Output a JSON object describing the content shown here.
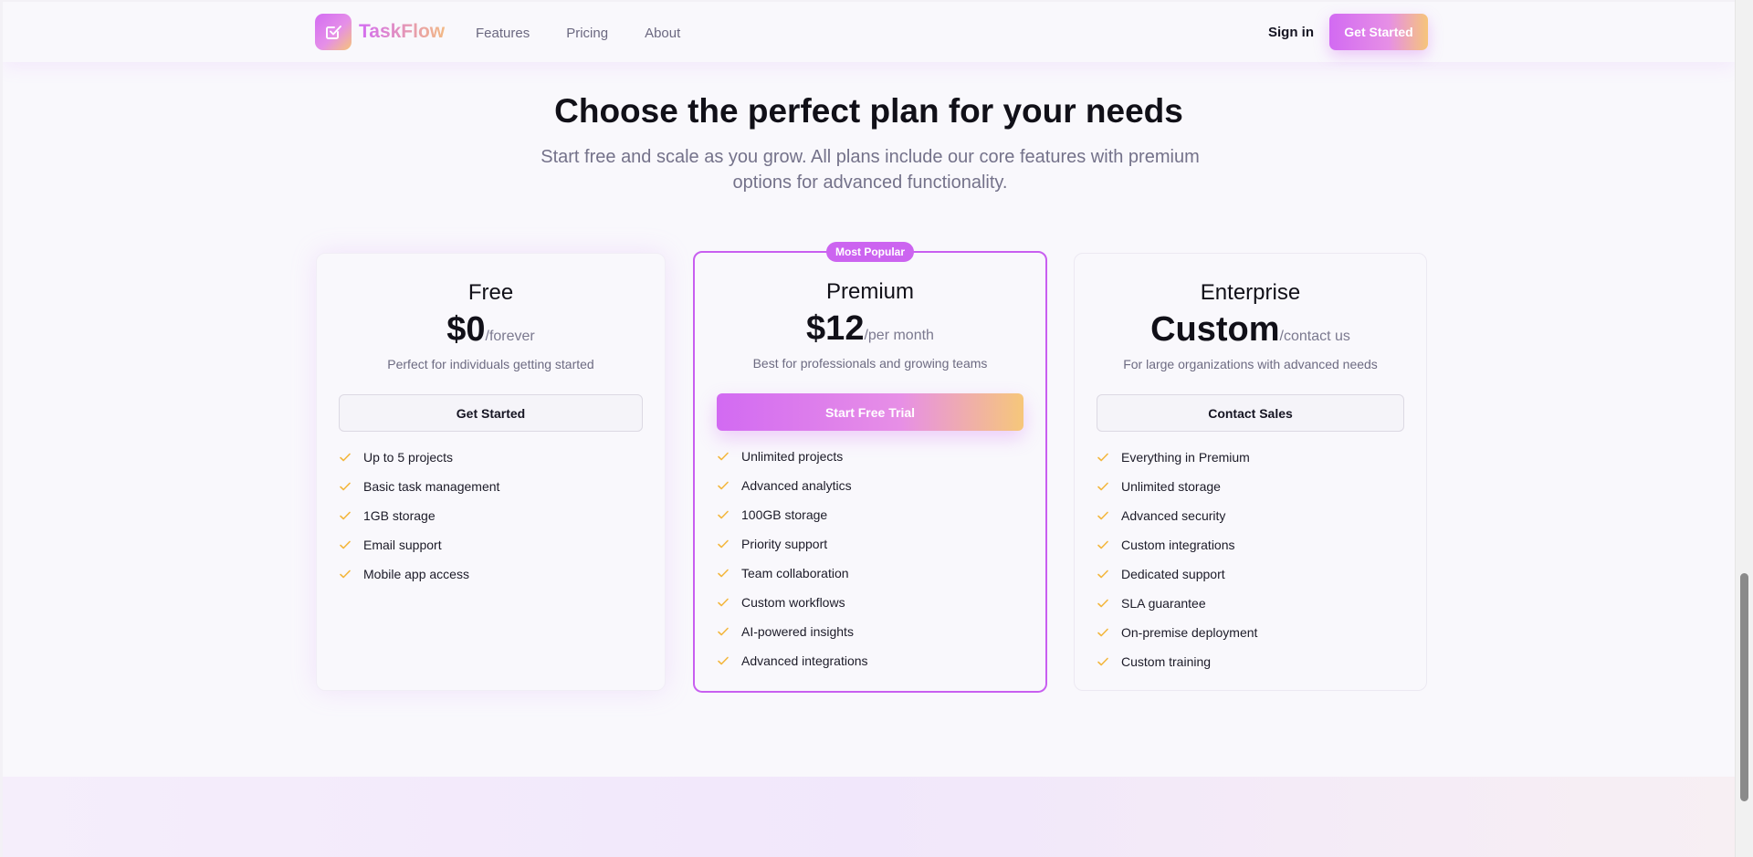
{
  "header": {
    "brand": "TaskFlow",
    "nav": [
      "Features",
      "Pricing",
      "About"
    ],
    "sign_in": "Sign in",
    "cta": "Get Started"
  },
  "hero": {
    "title": "Choose the perfect plan for your needs",
    "subtitle": "Start free and scale as you grow. All plans include our core features with premium options for advanced functionality."
  },
  "plans": [
    {
      "name": "Free",
      "price": "$0",
      "period": "/forever",
      "description": "Perfect for individuals getting started",
      "button": "Get Started",
      "features": [
        "Up to 5 projects",
        "Basic task management",
        "1GB storage",
        "Email support",
        "Mobile app access"
      ]
    },
    {
      "name": "Premium",
      "badge": "Most Popular",
      "price": "$12",
      "period": "/per month",
      "description": "Best for professionals and growing teams",
      "button": "Start Free Trial",
      "features": [
        "Unlimited projects",
        "Advanced analytics",
        "100GB storage",
        "Priority support",
        "Team collaboration",
        "Custom workflows",
        "AI-powered insights",
        "Advanced integrations"
      ]
    },
    {
      "name": "Enterprise",
      "price": "Custom",
      "period": "/contact us",
      "description": "For large organizations with advanced needs",
      "button": "Contact Sales",
      "features": [
        "Everything in Premium",
        "Unlimited storage",
        "Advanced security",
        "Custom integrations",
        "Dedicated support",
        "SLA guarantee",
        "On-premise deployment",
        "Custom training"
      ]
    }
  ],
  "icons": {
    "logo": "check-square-icon",
    "feature": "check-icon"
  },
  "colors": {
    "accent_purple": "#cc64f0",
    "accent_gold": "#f6c77a",
    "check": "#f3b73e"
  }
}
